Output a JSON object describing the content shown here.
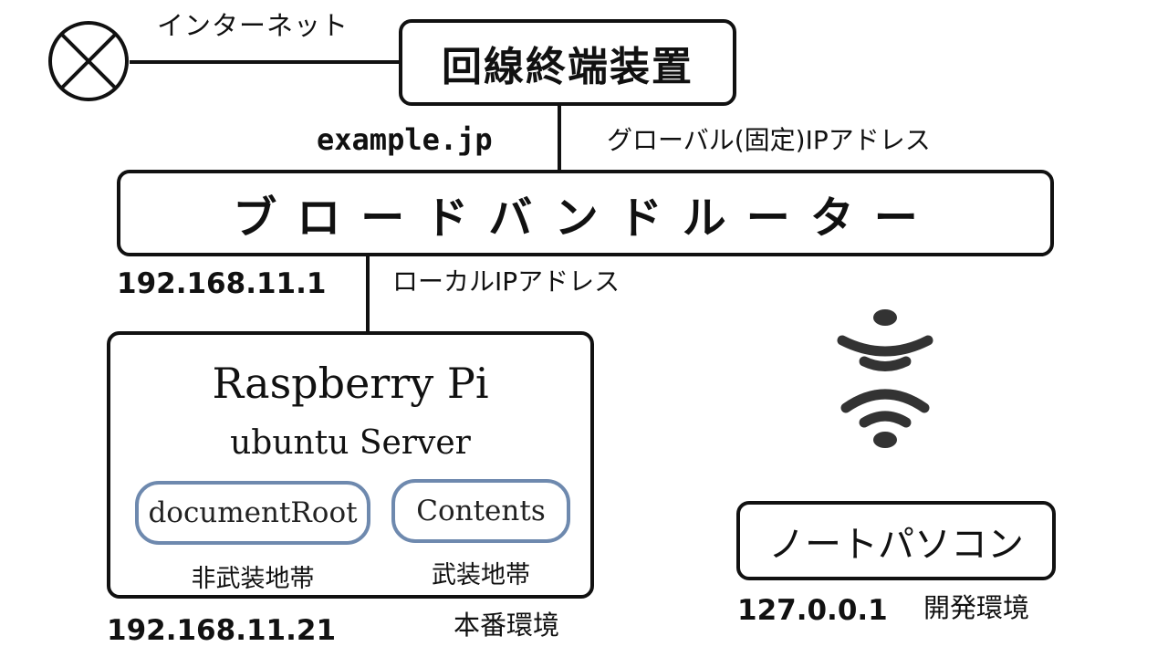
{
  "internet_label": "インターネット",
  "onu_label": "回線終端装置",
  "domain": "example.jp",
  "global_ip_label": "グローバル(固定)IPアドレス",
  "router_label": "ブロードバンドルーター",
  "router_ip": "192.168.11.1",
  "local_ip_label": "ローカルIPアドレス",
  "raspberry": {
    "title": "Raspberry Pi",
    "os": "ubuntu Server",
    "dirs": [
      {
        "name": "documentRoot",
        "zone": "非武装地帯"
      },
      {
        "name": "Contents",
        "zone": "武装地帯"
      }
    ],
    "ip": "192.168.11.21",
    "env": "本番環境"
  },
  "laptop": {
    "label": "ノートパソコン",
    "ip": "127.0.0.1",
    "env": "開発環境"
  },
  "icons": {
    "internet": "globe-cross-icon",
    "wifi": "wifi-icon"
  }
}
